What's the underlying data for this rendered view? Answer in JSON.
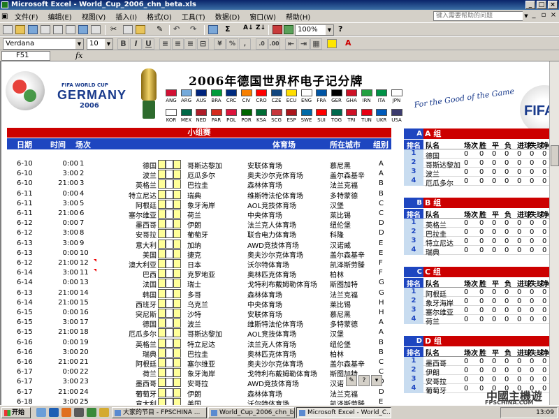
{
  "window": {
    "title": "Microsoft Excel - World_Cup_2006_chn_beta.xls"
  },
  "menu": {
    "items": [
      "文件(F)",
      "编辑(E)",
      "视图(V)",
      "插入(I)",
      "格式(O)",
      "工具(T)",
      "数据(D)",
      "窗口(W)",
      "帮助(H)"
    ],
    "help_placeholder": "键入需要帮助的问题"
  },
  "toolbar": {
    "zoom": "100%",
    "font": "Verdana",
    "size": "10"
  },
  "formula_bar": {
    "cell_ref": "F51",
    "fx": "fx"
  },
  "header": {
    "logo_small": "FIFA WORLD CUP",
    "logo_big": "GERMANY",
    "logo_year": "2006",
    "title": "2006年德国世界杯电子记分牌",
    "slogan": "For the Good of the Game",
    "fifa_logo": "FIFA",
    "flags_row1": [
      "ANG",
      "ARG",
      "AUS",
      "BRA",
      "CRC",
      "CIV",
      "CRO",
      "CZE",
      "ECU",
      "ENG",
      "FRA",
      "GER",
      "GHA",
      "IRN",
      "ITA",
      "JPN"
    ],
    "flags_row2": [
      "KOR",
      "MEX",
      "NED",
      "PAR",
      "POL",
      "POR",
      "KSA",
      "SCG",
      "ESP",
      "SWE",
      "SUI",
      "TOG",
      "TRI",
      "TUN",
      "UKR",
      "USA"
    ],
    "flag_colors1": [
      "#d21034",
      "#75aadb",
      "#00247d",
      "#009c3b",
      "#002b7f",
      "#f77f00",
      "#ff0000",
      "#11457e",
      "#ffdd00",
      "#ffffff",
      "#0055a4",
      "#000000",
      "#ce1126",
      "#239f40",
      "#009246",
      "#ffffff"
    ],
    "flag_colors2": [
      "#ffffff",
      "#006847",
      "#ae1c28",
      "#d52b1e",
      "#dc143c",
      "#006600",
      "#006c35",
      "#c6363c",
      "#aa151b",
      "#006aa7",
      "#ff0000",
      "#006a4e",
      "#ce1126",
      "#e70013",
      "#005bbb",
      "#3c3b6e"
    ]
  },
  "matches": {
    "section_title": "小组赛",
    "columns": {
      "date": "日期",
      "time": "时间",
      "no": "场次",
      "venue": "体育场",
      "city": "所在城市",
      "group": "组别"
    },
    "rows": [
      {
        "date": "6-10",
        "time": "0:00",
        "no": "1",
        "a": "德国",
        "b": "哥斯达黎加",
        "venue": "安联体育场",
        "city": "慕尼黑",
        "group": "A"
      },
      {
        "date": "6-10",
        "time": "3:00",
        "no": "2",
        "a": "波兰",
        "b": "厄瓜多尔",
        "venue": "奥夫沙尔克体育场",
        "city": "盖尔森基辛",
        "group": "A"
      },
      {
        "date": "6-10",
        "time": "21:00",
        "no": "3",
        "a": "英格兰",
        "b": "巴拉圭",
        "venue": "森林体育场",
        "city": "法兰克福",
        "group": "B"
      },
      {
        "date": "6-11",
        "time": "0:00",
        "no": "4",
        "a": "特立尼达",
        "b": "瑞典",
        "venue": "维斯特法伦体育场",
        "city": "多特蒙德",
        "group": "B"
      },
      {
        "date": "6-11",
        "time": "3:00",
        "no": "5",
        "a": "阿根廷",
        "b": "象牙海岸",
        "venue": "AOL竞技体育场",
        "city": "汉堡",
        "group": "C"
      },
      {
        "date": "6-11",
        "time": "21:00",
        "no": "6",
        "a": "塞尔维亚",
        "b": "荷兰",
        "venue": "中央体育场",
        "city": "莱比锡",
        "group": "C"
      },
      {
        "date": "6-12",
        "time": "0:00",
        "no": "7",
        "a": "墨西哥",
        "b": "伊朗",
        "venue": "法兰克人体育场",
        "city": "纽伦堡",
        "group": "D"
      },
      {
        "date": "6-12",
        "time": "3:00",
        "no": "8",
        "a": "安哥拉",
        "b": "葡萄牙",
        "venue": "联合电力体育场",
        "city": "科隆",
        "group": "D"
      },
      {
        "date": "6-13",
        "time": "3:00",
        "no": "9",
        "a": "意大利",
        "b": "加纳",
        "venue": "AWD竞技体育场",
        "city": "汉诺威",
        "group": "E"
      },
      {
        "date": "6-13",
        "time": "0:00",
        "no": "10",
        "a": "美国",
        "b": "捷克",
        "venue": "奥夫沙尔克体育场",
        "city": "盖尔森基辛",
        "group": "E"
      },
      {
        "date": "6-12",
        "time": "21:00",
        "no": "12",
        "a": "澳大利亚",
        "b": "日本",
        "venue": "沃尔特体育场",
        "city": "凯泽斯劳滕",
        "group": "F",
        "mark": true
      },
      {
        "date": "6-14",
        "time": "3:00",
        "no": "11",
        "a": "巴西",
        "b": "克罗地亚",
        "venue": "奥林匹克体育场",
        "city": "柏林",
        "group": "F",
        "mark": true
      },
      {
        "date": "6-14",
        "time": "0:00",
        "no": "13",
        "a": "法国",
        "b": "瑞士",
        "venue": "戈特利布戴姆勒体育场",
        "city": "斯图加特",
        "group": "G"
      },
      {
        "date": "6-13",
        "time": "21:00",
        "no": "14",
        "a": "韩国",
        "b": "多哥",
        "venue": "森林体育场",
        "city": "法兰克福",
        "group": "G"
      },
      {
        "date": "6-14",
        "time": "21:00",
        "no": "15",
        "a": "西班牙",
        "b": "乌克兰",
        "venue": "中央体育场",
        "city": "莱比锡",
        "group": "H"
      },
      {
        "date": "6-15",
        "time": "0:00",
        "no": "16",
        "a": "突尼斯",
        "b": "沙特",
        "venue": "安联体育场",
        "city": "慕尼黑",
        "group": "H"
      },
      {
        "date": "6-15",
        "time": "3:00",
        "no": "17",
        "a": "德国",
        "b": "波兰",
        "venue": "维斯特法伦体育场",
        "city": "多特蒙德",
        "group": "A"
      },
      {
        "date": "6-15",
        "time": "21:00",
        "no": "18",
        "a": "厄瓜多尔",
        "b": "哥斯达黎加",
        "venue": "AOL竞技体育场",
        "city": "汉堡",
        "group": "A"
      },
      {
        "date": "6-16",
        "time": "0:00",
        "no": "19",
        "a": "英格兰",
        "b": "特立尼达",
        "venue": "法兰克人体育场",
        "city": "纽伦堡",
        "group": "B"
      },
      {
        "date": "6-16",
        "time": "3:00",
        "no": "20",
        "a": "瑞典",
        "b": "巴拉圭",
        "venue": "奥林匹克体育场",
        "city": "柏林",
        "group": "B"
      },
      {
        "date": "6-16",
        "time": "21:00",
        "no": "21",
        "a": "阿根廷",
        "b": "塞尔维亚",
        "venue": "奥夫沙尔克体育场",
        "city": "盖尔森基辛",
        "group": "C"
      },
      {
        "date": "6-17",
        "time": "0:00",
        "no": "22",
        "a": "荷兰",
        "b": "象牙海岸",
        "venue": "戈特利布戴姆勒体育场",
        "city": "斯图加特",
        "group": "C"
      },
      {
        "date": "6-17",
        "time": "3:00",
        "no": "23",
        "a": "墨西哥",
        "b": "安哥拉",
        "venue": "AWD竞技体育场",
        "city": "汉诺",
        "group": "D"
      },
      {
        "date": "6-17",
        "time": "21:00",
        "no": "24",
        "a": "葡萄牙",
        "b": "伊朗",
        "venue": "森林体育场",
        "city": "法兰克福",
        "group": "D"
      },
      {
        "date": "6-18",
        "time": "3:00",
        "no": "25",
        "a": "意大利",
        "b": "美国",
        "venue": "沃尔特体育场",
        "city": "凯泽斯劳滕",
        "group": "E"
      }
    ]
  },
  "standings": {
    "rank_label": "排名",
    "col_labels": [
      "队名",
      "场次",
      "胜",
      "平",
      "负",
      "进球",
      "失球",
      "净"
    ],
    "groups": [
      {
        "letter": "A",
        "title": "A 组",
        "teams": [
          "德国",
          "哥斯达黎加",
          "波兰",
          "厄瓜多尔"
        ]
      },
      {
        "letter": "B",
        "title": "B 组",
        "teams": [
          "英格兰",
          "巴拉圭",
          "特立尼达",
          "瑞典"
        ]
      },
      {
        "letter": "C",
        "title": "C 组",
        "teams": [
          "阿根廷",
          "象牙海岸",
          "塞尔维亚",
          "荷兰"
        ]
      },
      {
        "letter": "D",
        "title": "D 组",
        "teams": [
          "墨西哥",
          "伊朗",
          "安哥拉",
          "葡萄牙"
        ]
      }
    ],
    "zero": "0"
  },
  "taskbar": {
    "start": "开始",
    "tasks": [
      "大家的节目 - FPSCHINA ...",
      "World_Cup_2006_chn_beta",
      "Microsoft Excel - World_C..."
    ],
    "clock": "13:09"
  },
  "watermark": {
    "main": "中國主機遊",
    "sub": "FPSCHINA.COM"
  }
}
